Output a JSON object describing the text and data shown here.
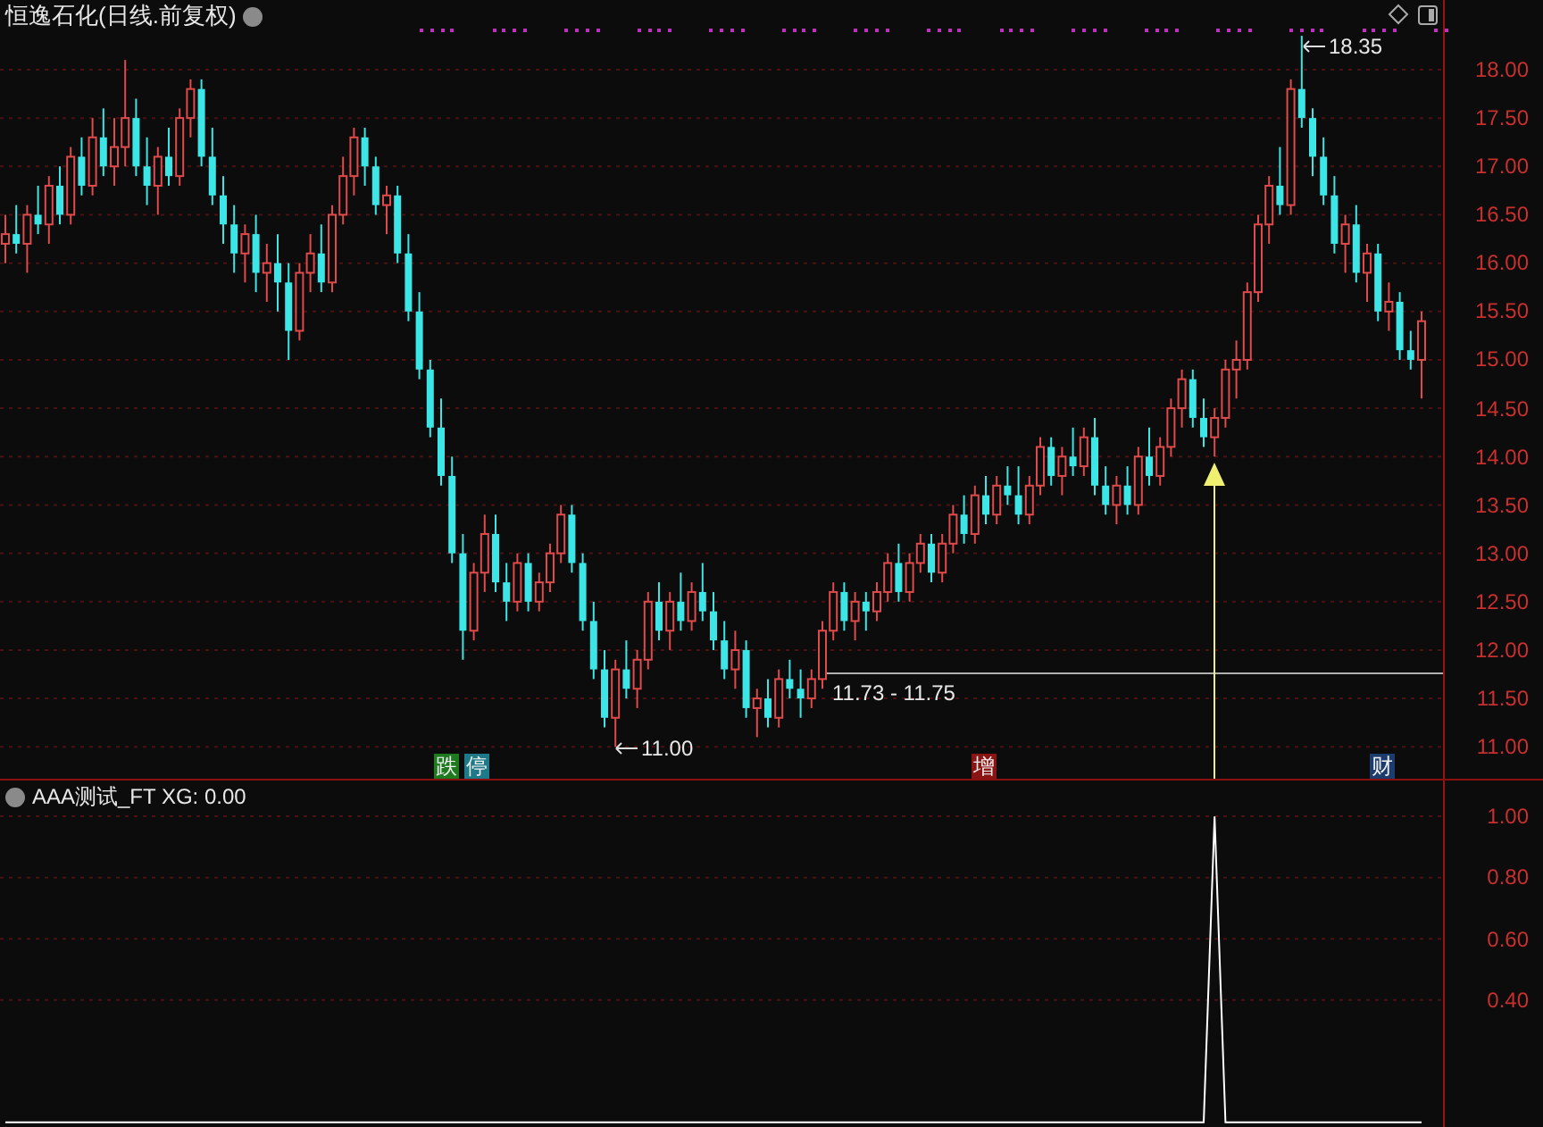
{
  "title": "恒逸石化(日线.前复权)",
  "price_chart": {
    "chart_data": {
      "type": "candlestick",
      "grid": true,
      "ylim": [
        10.67,
        18.72
      ],
      "yticks": [
        {
          "value": 18,
          "label": "18.00"
        },
        {
          "value": 17.5,
          "label": "17.50"
        },
        {
          "value": 17,
          "label": "17.00"
        },
        {
          "value": 16.5,
          "label": "16.50"
        },
        {
          "value": 16,
          "label": "16.00"
        },
        {
          "value": 15.5,
          "label": "15.50"
        },
        {
          "value": 15,
          "label": "15.00"
        },
        {
          "value": 14.5,
          "label": "14.50"
        },
        {
          "value": 14,
          "label": "14.00"
        },
        {
          "value": 13.5,
          "label": "13.50"
        },
        {
          "value": 13,
          "label": "13.00"
        },
        {
          "value": 12.5,
          "label": "12.50"
        },
        {
          "value": 12,
          "label": "12.00"
        },
        {
          "value": 11.5,
          "label": "11.50"
        },
        {
          "value": 11,
          "label": "11.00"
        }
      ],
      "ohlc": [
        [
          16.2,
          16.5,
          16.0,
          16.3
        ],
        [
          16.3,
          16.6,
          16.1,
          16.2
        ],
        [
          16.2,
          16.6,
          15.9,
          16.5
        ],
        [
          16.5,
          16.8,
          16.3,
          16.4
        ],
        [
          16.4,
          16.9,
          16.2,
          16.8
        ],
        [
          16.8,
          17.0,
          16.4,
          16.5
        ],
        [
          16.5,
          17.2,
          16.4,
          17.1
        ],
        [
          17.1,
          17.3,
          16.7,
          16.8
        ],
        [
          16.8,
          17.5,
          16.7,
          17.3
        ],
        [
          17.3,
          17.6,
          16.9,
          17.0
        ],
        [
          17.0,
          17.5,
          16.8,
          17.2
        ],
        [
          17.2,
          18.1,
          17.0,
          17.5
        ],
        [
          17.5,
          17.7,
          16.9,
          17.0
        ],
        [
          17.0,
          17.3,
          16.6,
          16.8
        ],
        [
          16.8,
          17.2,
          16.5,
          17.1
        ],
        [
          17.1,
          17.4,
          16.8,
          16.9
        ],
        [
          16.9,
          17.6,
          16.8,
          17.5
        ],
        [
          17.5,
          17.9,
          17.3,
          17.8
        ],
        [
          17.8,
          17.9,
          17.0,
          17.1
        ],
        [
          17.1,
          17.4,
          16.6,
          16.7
        ],
        [
          16.7,
          16.9,
          16.2,
          16.4
        ],
        [
          16.4,
          16.6,
          15.9,
          16.1
        ],
        [
          16.1,
          16.4,
          15.8,
          16.3
        ],
        [
          16.3,
          16.5,
          15.7,
          15.9
        ],
        [
          15.9,
          16.2,
          15.6,
          16.0
        ],
        [
          16.0,
          16.3,
          15.5,
          15.8
        ],
        [
          15.8,
          16.0,
          15.0,
          15.3
        ],
        [
          15.3,
          16.0,
          15.2,
          15.9
        ],
        [
          15.9,
          16.3,
          15.7,
          16.1
        ],
        [
          16.1,
          16.4,
          15.7,
          15.8
        ],
        [
          15.8,
          16.6,
          15.7,
          16.5
        ],
        [
          16.5,
          17.1,
          16.4,
          16.9
        ],
        [
          16.9,
          17.4,
          16.7,
          17.3
        ],
        [
          17.3,
          17.4,
          16.8,
          17.0
        ],
        [
          17.0,
          17.1,
          16.5,
          16.6
        ],
        [
          16.6,
          16.8,
          16.3,
          16.7
        ],
        [
          16.7,
          16.8,
          16.0,
          16.1
        ],
        [
          16.1,
          16.3,
          15.4,
          15.5
        ],
        [
          15.5,
          15.7,
          14.8,
          14.9
        ],
        [
          14.9,
          15.0,
          14.2,
          14.3
        ],
        [
          14.3,
          14.6,
          13.7,
          13.8
        ],
        [
          13.8,
          14.0,
          12.9,
          13.0
        ],
        [
          13.0,
          13.2,
          11.9,
          12.2
        ],
        [
          12.2,
          12.9,
          12.1,
          12.8
        ],
        [
          12.8,
          13.4,
          12.6,
          13.2
        ],
        [
          13.2,
          13.4,
          12.6,
          12.7
        ],
        [
          12.7,
          12.9,
          12.3,
          12.5
        ],
        [
          12.5,
          13.0,
          12.4,
          12.9
        ],
        [
          12.9,
          13.0,
          12.4,
          12.5
        ],
        [
          12.5,
          12.8,
          12.4,
          12.7
        ],
        [
          12.7,
          13.1,
          12.6,
          13.0
        ],
        [
          13.0,
          13.5,
          12.9,
          13.4
        ],
        [
          13.4,
          13.5,
          12.8,
          12.9
        ],
        [
          12.9,
          13.0,
          12.2,
          12.3
        ],
        [
          12.3,
          12.5,
          11.7,
          11.8
        ],
        [
          11.8,
          12.0,
          11.2,
          11.3
        ],
        [
          11.3,
          11.9,
          11.0,
          11.8
        ],
        [
          11.8,
          12.1,
          11.5,
          11.6
        ],
        [
          11.6,
          12.0,
          11.4,
          11.9
        ],
        [
          11.9,
          12.6,
          11.8,
          12.5
        ],
        [
          12.5,
          12.7,
          12.1,
          12.2
        ],
        [
          12.2,
          12.6,
          12.0,
          12.5
        ],
        [
          12.5,
          12.8,
          12.2,
          12.3
        ],
        [
          12.3,
          12.7,
          12.2,
          12.6
        ],
        [
          12.6,
          12.9,
          12.3,
          12.4
        ],
        [
          12.4,
          12.6,
          12.0,
          12.1
        ],
        [
          12.1,
          12.3,
          11.7,
          11.8
        ],
        [
          11.8,
          12.2,
          11.6,
          12.0
        ],
        [
          12.0,
          12.1,
          11.3,
          11.4
        ],
        [
          11.4,
          11.6,
          11.1,
          11.5
        ],
        [
          11.5,
          11.7,
          11.2,
          11.3
        ],
        [
          11.3,
          11.8,
          11.2,
          11.7
        ],
        [
          11.7,
          11.9,
          11.5,
          11.6
        ],
        [
          11.6,
          11.8,
          11.3,
          11.5
        ],
        [
          11.5,
          11.8,
          11.4,
          11.7
        ],
        [
          11.7,
          12.3,
          11.6,
          12.2
        ],
        [
          12.2,
          12.7,
          12.1,
          12.6
        ],
        [
          12.6,
          12.7,
          12.2,
          12.3
        ],
        [
          12.3,
          12.6,
          12.1,
          12.5
        ],
        [
          12.5,
          12.6,
          12.2,
          12.4
        ],
        [
          12.4,
          12.7,
          12.3,
          12.6
        ],
        [
          12.6,
          13.0,
          12.5,
          12.9
        ],
        [
          12.9,
          13.1,
          12.5,
          12.6
        ],
        [
          12.6,
          13.0,
          12.5,
          12.9
        ],
        [
          12.9,
          13.2,
          12.8,
          13.1
        ],
        [
          13.1,
          13.2,
          12.7,
          12.8
        ],
        [
          12.8,
          13.2,
          12.7,
          13.1
        ],
        [
          13.1,
          13.5,
          13.0,
          13.4
        ],
        [
          13.4,
          13.6,
          13.1,
          13.2
        ],
        [
          13.2,
          13.7,
          13.1,
          13.6
        ],
        [
          13.6,
          13.8,
          13.3,
          13.4
        ],
        [
          13.4,
          13.8,
          13.3,
          13.7
        ],
        [
          13.7,
          13.9,
          13.5,
          13.6
        ],
        [
          13.6,
          13.9,
          13.3,
          13.4
        ],
        [
          13.4,
          13.8,
          13.3,
          13.7
        ],
        [
          13.7,
          14.2,
          13.6,
          14.1
        ],
        [
          14.1,
          14.2,
          13.7,
          13.8
        ],
        [
          13.8,
          14.1,
          13.6,
          14.0
        ],
        [
          14.0,
          14.3,
          13.8,
          13.9
        ],
        [
          13.9,
          14.3,
          13.8,
          14.2
        ],
        [
          14.2,
          14.4,
          13.6,
          13.7
        ],
        [
          13.7,
          13.9,
          13.4,
          13.5
        ],
        [
          13.5,
          13.8,
          13.3,
          13.7
        ],
        [
          13.7,
          13.9,
          13.4,
          13.5
        ],
        [
          13.5,
          14.1,
          13.4,
          14.0
        ],
        [
          14.0,
          14.3,
          13.7,
          13.8
        ],
        [
          13.8,
          14.2,
          13.7,
          14.1
        ],
        [
          14.1,
          14.6,
          14.0,
          14.5
        ],
        [
          14.5,
          14.9,
          14.3,
          14.8
        ],
        [
          14.8,
          14.9,
          14.3,
          14.4
        ],
        [
          14.4,
          14.6,
          14.1,
          14.2
        ],
        [
          14.2,
          14.5,
          14.0,
          14.4
        ],
        [
          14.4,
          15.0,
          14.3,
          14.9
        ],
        [
          14.9,
          15.2,
          14.6,
          15.0
        ],
        [
          15.0,
          15.8,
          14.9,
          15.7
        ],
        [
          15.7,
          16.5,
          15.6,
          16.4
        ],
        [
          16.4,
          16.9,
          16.2,
          16.8
        ],
        [
          16.8,
          17.2,
          16.5,
          16.6
        ],
        [
          16.6,
          17.9,
          16.5,
          17.8
        ],
        [
          17.8,
          18.35,
          17.4,
          17.5
        ],
        [
          17.5,
          17.6,
          16.9,
          17.1
        ],
        [
          17.1,
          17.3,
          16.6,
          16.7
        ],
        [
          16.7,
          16.9,
          16.1,
          16.2
        ],
        [
          16.2,
          16.5,
          15.9,
          16.4
        ],
        [
          16.4,
          16.6,
          15.8,
          15.9
        ],
        [
          15.9,
          16.2,
          15.6,
          16.1
        ],
        [
          16.1,
          16.2,
          15.4,
          15.5
        ],
        [
          15.5,
          15.8,
          15.3,
          15.6
        ],
        [
          15.6,
          15.7,
          15.0,
          15.1
        ],
        [
          15.1,
          15.3,
          14.9,
          15.0
        ],
        [
          15.0,
          15.5,
          14.6,
          15.4
        ]
      ]
    }
  },
  "annotations": [
    {
      "kind": "high",
      "text": "18.35"
    },
    {
      "kind": "low",
      "text": "11.00"
    },
    {
      "kind": "range",
      "text": "11.73 - 11.75"
    }
  ],
  "markers": [
    {
      "text": "跌",
      "color": "#1e7a1e"
    },
    {
      "text": "停",
      "color": "#1e7a88"
    },
    {
      "text": "增",
      "color": "#8a1414"
    },
    {
      "text": "财",
      "color": "#1c3c6e"
    }
  ],
  "indicator": {
    "label": "AAA测试_FT XG: 0.00",
    "chart_data": {
      "type": "line",
      "grid": true,
      "ylim": [
        -0.015,
        1.117
      ],
      "yticks": [
        {
          "value": 1,
          "label": "1.00"
        },
        {
          "value": 0.8,
          "label": "0.80"
        },
        {
          "value": 0.6,
          "label": "0.60"
        },
        {
          "value": 0.4,
          "label": "0.40"
        }
      ],
      "series": [
        {
          "color": "#ffffff",
          "values": [
            0,
            0,
            0,
            0,
            0,
            0,
            0,
            0,
            0,
            0,
            0,
            0,
            0,
            0,
            0,
            0,
            0,
            0,
            0,
            0,
            0,
            0,
            0,
            0,
            0,
            0,
            0,
            0,
            0,
            0,
            0,
            0,
            0,
            0,
            0,
            0,
            0,
            0,
            0,
            0,
            0,
            0,
            0,
            0,
            0,
            0,
            0,
            0,
            0,
            0,
            0,
            0,
            0,
            0,
            0,
            0,
            0,
            0,
            0,
            0,
            0,
            0,
            0,
            0,
            0,
            0,
            0,
            0,
            0,
            0,
            0,
            0,
            0,
            0,
            0,
            0,
            0,
            0,
            0,
            0,
            0,
            0,
            0,
            0,
            0,
            0,
            0,
            0,
            0,
            0,
            0,
            0,
            0,
            0,
            0,
            0,
            0,
            0,
            0,
            0,
            0,
            0,
            0,
            0,
            0,
            0,
            0,
            0,
            0,
            0,
            0,
            1,
            0,
            0,
            0,
            0,
            0,
            0,
            0,
            0,
            0,
            0,
            0,
            0,
            0,
            0,
            0,
            0,
            0,
            0,
            0
          ]
        }
      ]
    }
  }
}
